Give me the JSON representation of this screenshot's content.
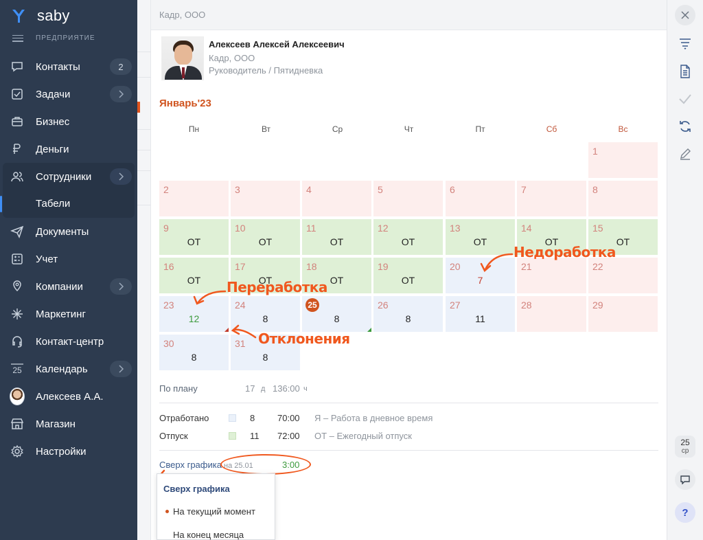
{
  "app": {
    "brand": "saby",
    "section_caption": "ПРЕДПРИЯТИЕ"
  },
  "sidebar": {
    "items": [
      {
        "label": "Контакты",
        "icon": "contacts-icon",
        "badge": "2"
      },
      {
        "label": "Задачи",
        "icon": "tasks-icon",
        "chevron": true
      },
      {
        "label": "Бизнес",
        "icon": "business-icon"
      },
      {
        "label": "Деньги",
        "icon": "money-icon"
      },
      {
        "label": "Сотрудники",
        "icon": "employees-icon",
        "chevron": true
      },
      {
        "label": "Документы",
        "icon": "documents-icon"
      },
      {
        "label": "Учет",
        "icon": "accounting-icon"
      },
      {
        "label": "Компании",
        "icon": "companies-icon",
        "chevron": true
      },
      {
        "label": "Маркетинг",
        "icon": "marketing-icon"
      },
      {
        "label": "Контакт-центр",
        "icon": "headset-icon"
      },
      {
        "label": "Календарь",
        "icon": "calendar-icon",
        "chevron": true,
        "icon_text": "25"
      },
      {
        "label": "Алексеев А.А.",
        "icon": "avatar"
      },
      {
        "label": "Магазин",
        "icon": "store-icon"
      },
      {
        "label": "Настройки",
        "icon": "settings-icon"
      }
    ],
    "sub_item": "Табели"
  },
  "panel": {
    "header": "Кадр, ООО",
    "employee": {
      "name": "Алексеев Алексей Алексеевич",
      "org": "Кадр, ООО",
      "role": "Руководитель / Пятидневка"
    },
    "month": "Январь'23",
    "weekdays": [
      "Пн",
      "Вт",
      "Ср",
      "Чт",
      "Пт",
      "Сб",
      "Вс"
    ],
    "days": [
      {
        "n": "1",
        "v": "",
        "type": "weekend"
      },
      {
        "n": "2",
        "v": "",
        "type": "weekend"
      },
      {
        "n": "3",
        "v": "",
        "type": "weekend"
      },
      {
        "n": "4",
        "v": "",
        "type": "weekend"
      },
      {
        "n": "5",
        "v": "",
        "type": "weekend"
      },
      {
        "n": "6",
        "v": "",
        "type": "weekend"
      },
      {
        "n": "7",
        "v": "",
        "type": "weekend"
      },
      {
        "n": "8",
        "v": "",
        "type": "weekend"
      },
      {
        "n": "9",
        "v": "ОТ",
        "type": "vacation"
      },
      {
        "n": "10",
        "v": "ОТ",
        "type": "vacation"
      },
      {
        "n": "11",
        "v": "ОТ",
        "type": "vacation"
      },
      {
        "n": "12",
        "v": "ОТ",
        "type": "vacation"
      },
      {
        "n": "13",
        "v": "ОТ",
        "type": "vacation"
      },
      {
        "n": "14",
        "v": "ОТ",
        "type": "vacation"
      },
      {
        "n": "15",
        "v": "ОТ",
        "type": "vacation"
      },
      {
        "n": "16",
        "v": "ОТ",
        "type": "vacation"
      },
      {
        "n": "17",
        "v": "ОТ",
        "type": "vacation"
      },
      {
        "n": "18",
        "v": "ОТ",
        "type": "vacation"
      },
      {
        "n": "19",
        "v": "ОТ",
        "type": "vacation"
      },
      {
        "n": "20",
        "v": "7",
        "type": "work",
        "tone": "red"
      },
      {
        "n": "21",
        "v": "",
        "type": "weekend"
      },
      {
        "n": "22",
        "v": "",
        "type": "weekend"
      },
      {
        "n": "23",
        "v": "12",
        "type": "work",
        "tone": "green"
      },
      {
        "n": "24",
        "v": "8",
        "type": "work"
      },
      {
        "n": "25",
        "v": "8",
        "type": "work",
        "today": true
      },
      {
        "n": "26",
        "v": "8",
        "type": "work"
      },
      {
        "n": "27",
        "v": "11",
        "type": "work"
      },
      {
        "n": "28",
        "v": "",
        "type": "weekend"
      },
      {
        "n": "29",
        "v": "",
        "type": "weekend"
      },
      {
        "n": "30",
        "v": "8",
        "type": "work"
      },
      {
        "n": "31",
        "v": "8",
        "type": "work"
      }
    ],
    "annotations": {
      "underwork": "Недоработка",
      "overwork": "Переработка",
      "deviations": "Отклонения"
    },
    "plan": {
      "label": "По плану",
      "days": "17",
      "days_unit": "д",
      "hours": "136:00",
      "hours_unit": "ч"
    },
    "summary": [
      {
        "label": "Отработано",
        "days": "8",
        "hours": "70:00",
        "desc": "Я – Работа в дневное время",
        "color": "#ebf1fa"
      },
      {
        "label": "Отпуск",
        "days": "11",
        "hours": "72:00",
        "desc": "ОТ – Ежегодный отпуск",
        "color": "#dff0d6"
      }
    ],
    "overtime": {
      "label": "Сверх графика",
      "on": "на 25.01",
      "value": "3:00"
    },
    "dropdown": {
      "title": "Сверх графика",
      "options": [
        "На текущий момент",
        "На конец месяца"
      ],
      "selected": "На текущий момент"
    }
  },
  "rail": {
    "calendar_day": "25",
    "calendar_weekday": "ср",
    "help": "?"
  },
  "colors": {
    "accent": "#d0541f",
    "annotation": "#f0581e",
    "sidebar": "#2d3b4f"
  }
}
